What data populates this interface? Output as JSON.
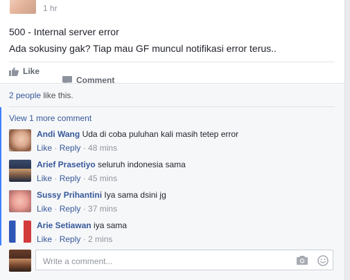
{
  "post": {
    "timestamp": "1 hr",
    "body_lines": [
      "500 - Internal server error",
      "Ada sokusiny gak? Tiap mau GF muncul notifikasi error terus.."
    ],
    "actions": {
      "like_label": "Like",
      "comment_label": "Comment"
    }
  },
  "feedback": {
    "likes_people": "2 people",
    "likes_suffix": " like this.",
    "view_more": "View 1 more comment",
    "comments": [
      {
        "author": "Andi Wang",
        "text": "Uda di coba puluhan kali masih tetep error",
        "like": "Like",
        "reply": "Reply",
        "time": "48 mins"
      },
      {
        "author": "Arief Prasetiyo",
        "text": "seluruh indonesia sama",
        "like": "Like",
        "reply": "Reply",
        "time": "45 mins"
      },
      {
        "author": "Sussy Prihantini",
        "text": "Iya sama dsini jg",
        "like": "Like",
        "reply": "Reply",
        "time": "37 mins"
      },
      {
        "author": "Arie Setiawan",
        "text": "iya sama",
        "like": "Like",
        "reply": "Reply",
        "time": "2 mins"
      }
    ],
    "composer": {
      "placeholder": "Write a comment..."
    }
  },
  "icons": {
    "like": "thumbs-up-icon",
    "comment": "comment-bubble-icon",
    "camera": "camera-icon",
    "emoji": "smiley-icon"
  },
  "colors": {
    "link": "#365899",
    "meta": "#90949c",
    "accent_bar": "#4080ff"
  }
}
